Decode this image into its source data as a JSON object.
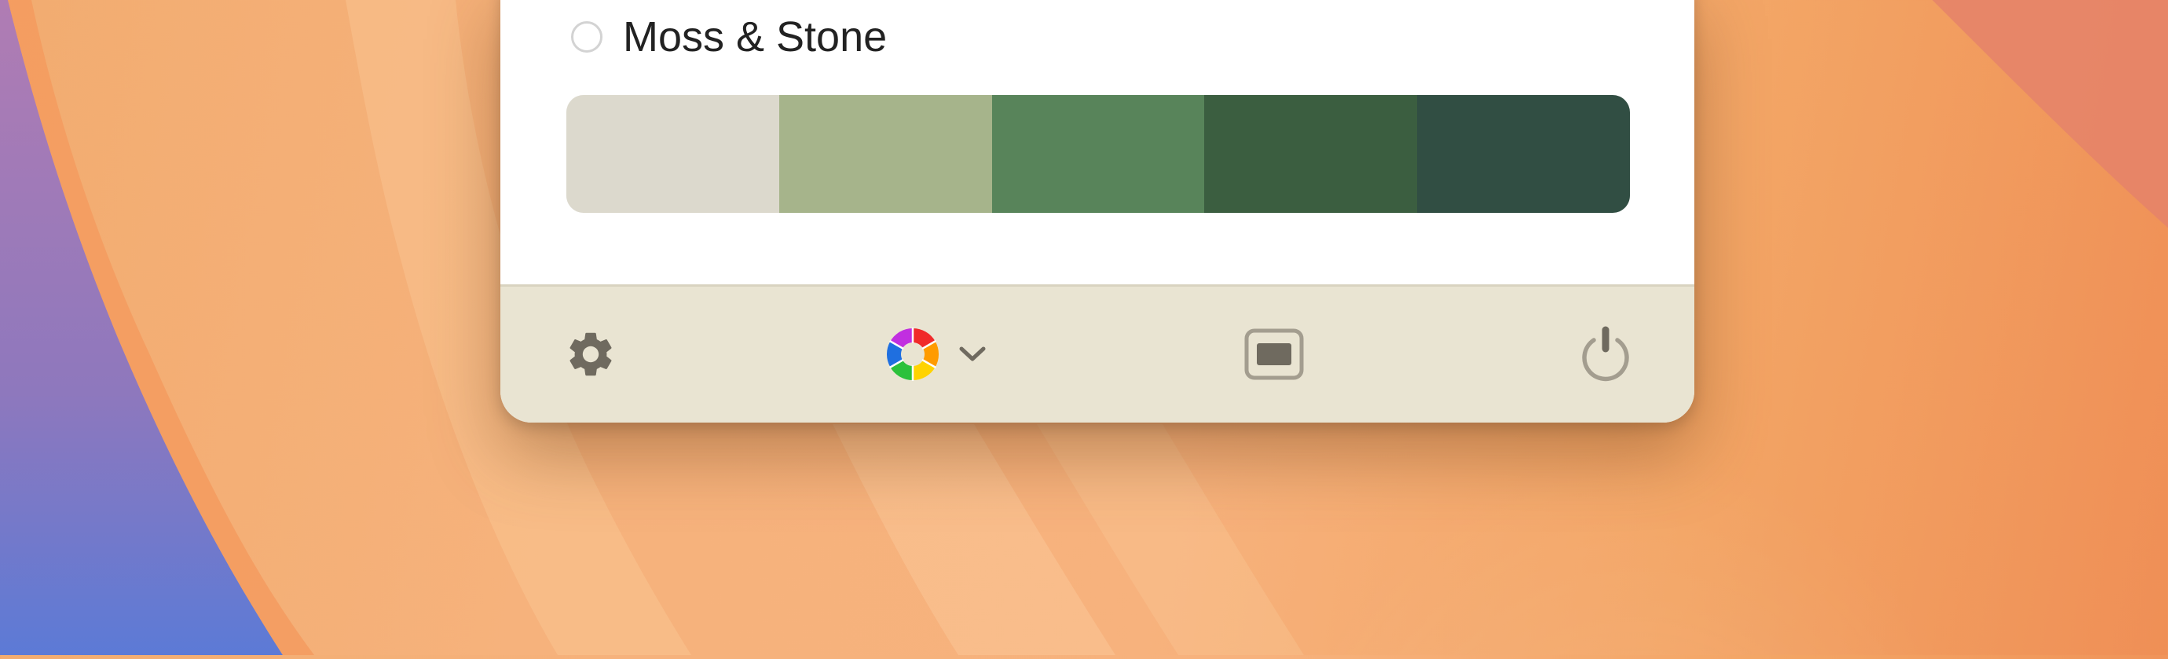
{
  "palette": {
    "name": "Moss & Stone",
    "selected": false,
    "swatches": [
      "#dcd9cd",
      "#a6b48b",
      "#58845a",
      "#3b5e40",
      "#314e43"
    ]
  },
  "footer": {
    "buttons": [
      {
        "name": "settings",
        "icon": "gear-icon"
      },
      {
        "name": "palette-picker",
        "icon": "color-wheel-icon",
        "dropdown": "chevron-down-icon"
      },
      {
        "name": "window-mode",
        "icon": "window-icon"
      },
      {
        "name": "power",
        "icon": "power-icon"
      }
    ],
    "icon_color": "#6f6a5f",
    "power_color": "#8d887c"
  },
  "colors": {
    "panel_bg": "#ffffff",
    "footer_bg": "#e9e4d2"
  }
}
